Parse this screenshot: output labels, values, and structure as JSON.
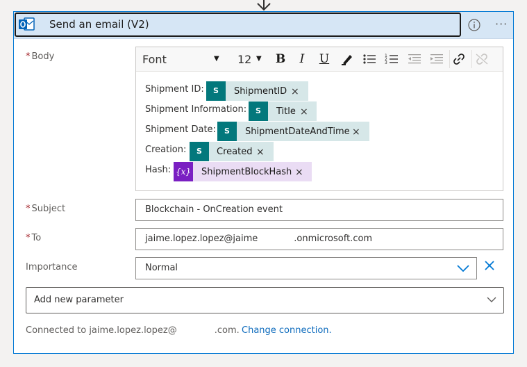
{
  "action": {
    "title": "Send an email (V2)"
  },
  "toolbar": {
    "font_label": "Font",
    "font_size": "12",
    "bold": "B",
    "italic": "I",
    "underline": "U"
  },
  "fields": {
    "required_marker": "*",
    "body_label": "Body",
    "subject_label": "Subject",
    "subject_value": "Blockchain - OnCreation event",
    "to_label": "To",
    "to_value_part1": "jaime.lopez.lopez@jaime",
    "to_value_part2": ".onmicrosoft.com",
    "importance_label": "Importance",
    "importance_value": "Normal"
  },
  "body_lines": [
    {
      "label": "Shipment ID:",
      "token": "ShipmentID",
      "kind": "sharepoint"
    },
    {
      "label": "Shipment Information:",
      "token": "Title",
      "kind": "sharepoint"
    },
    {
      "label": "Shipment Date:",
      "token": "ShipmentDateAndTime",
      "kind": "sharepoint"
    },
    {
      "label": "Creation:",
      "token": "Created",
      "kind": "sharepoint"
    },
    {
      "label": "Hash:",
      "token": "ShipmentBlockHash",
      "kind": "variable"
    }
  ],
  "token_icons": {
    "sharepoint": "S",
    "variable": "{x}",
    "remove": "×"
  },
  "add_parameter": "Add new parameter",
  "footer": {
    "connected_part1": "Connected to jaime.lopez.lopez@",
    "connected_part2": ".com.",
    "change_connection": "Change connection."
  },
  "colors": {
    "accent": "#0078d4",
    "header_bg": "#d6e6f5",
    "sharepoint_icon": "#03787c",
    "sharepoint_token_bg": "#d6e7e8",
    "variable_icon": "#7a1fc2",
    "variable_token_bg": "#eadcf4",
    "required": "#a4262c",
    "link": "#0f6cbd"
  }
}
